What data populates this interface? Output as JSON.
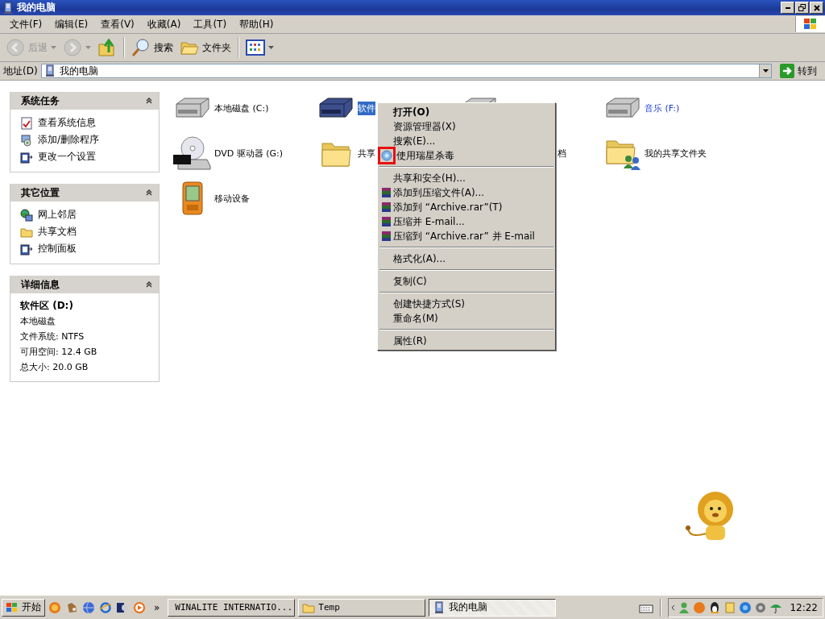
{
  "window": {
    "title": "我的电脑"
  },
  "menu_bar": [
    "文件(F)",
    "编辑(E)",
    "查看(V)",
    "收藏(A)",
    "工具(T)",
    "帮助(H)"
  ],
  "toolbar": [
    {
      "kind": "back",
      "label": "后退",
      "disabled": true
    },
    {
      "kind": "forward",
      "disabled": true
    },
    {
      "kind": "up",
      "disabled": false
    },
    {
      "kind": "search",
      "label": "搜索",
      "disabled": false
    },
    {
      "kind": "folders",
      "label": "文件夹",
      "disabled": false
    },
    {
      "kind": "views",
      "disabled": false
    }
  ],
  "address": {
    "label": "地址(D)",
    "value": "我的电脑",
    "go": "转到"
  },
  "sidebar": [
    {
      "title": "系统任务",
      "expanded": true,
      "items": [
        {
          "label": "查看系统信息"
        },
        {
          "label": "添加/删除程序"
        },
        {
          "label": "更改一个设置"
        }
      ]
    },
    {
      "title": "其它位置",
      "expanded": true,
      "items": [
        {
          "label": "网上邻居"
        },
        {
          "label": "共享文档"
        },
        {
          "label": "控制面板"
        }
      ]
    },
    {
      "title": "详细信息",
      "expanded": true,
      "details": [
        {
          "kind": "name",
          "text": "软件区 (D:)"
        },
        {
          "kind": "line",
          "text": "本地磁盘"
        },
        {
          "kind": "line",
          "text": "文件系统: NTFS"
        },
        {
          "kind": "line",
          "text": "可用空间: 12.4 GB"
        },
        {
          "kind": "line",
          "text": "总大小: 20.0 GB"
        }
      ]
    }
  ],
  "items": [
    {
      "kind": "hdd",
      "label": "本地磁盘 (C:)",
      "selected": false,
      "compressed": false
    },
    {
      "kind": "hdd-dark",
      "label": "软件",
      "selected": true,
      "compressed": false
    },
    {
      "kind": "hdd",
      "selected": false
    },
    {
      "kind": "hdd",
      "label": "音乐 (F:)",
      "selected": false,
      "compressed": true
    },
    {
      "kind": "dvd",
      "label": "DVD 驱动器 (G:)",
      "selected": false,
      "compressed": false
    },
    {
      "kind": "folder",
      "label": "共享",
      "selected": false,
      "compressed": false
    },
    {
      "kind": "folder",
      "label": "档",
      "selected": false,
      "compressed": false
    },
    {
      "kind": "shared",
      "label": "我的共享文件夹",
      "selected": false,
      "compressed": false
    },
    {
      "kind": "mobile",
      "label": "移动设备",
      "selected": false,
      "compressed": false
    }
  ],
  "context_menu": [
    {
      "kind": "plain",
      "label": "打开(O)",
      "default": true
    },
    {
      "kind": "plain",
      "label": "资源管理器(X)",
      "default": false
    },
    {
      "kind": "plain",
      "label": "搜索(E)...",
      "default": false
    },
    {
      "kind": "antivirus",
      "label": "使用瑞星杀毒",
      "default": false
    },
    {
      "kind": "separator"
    },
    {
      "kind": "plain",
      "label": "共享和安全(H)...",
      "default": false
    },
    {
      "kind": "archive",
      "label": "添加到压缩文件(A)...",
      "default": false
    },
    {
      "kind": "archive",
      "label": "添加到 “Archive.rar”(T)",
      "default": false
    },
    {
      "kind": "archive",
      "label": "压缩并 E-mail...",
      "default": false
    },
    {
      "kind": "archive",
      "label": "压缩到 “Archive.rar” 并 E-mail",
      "default": false
    },
    {
      "kind": "separator"
    },
    {
      "kind": "plain",
      "label": "格式化(A)...",
      "default": false
    },
    {
      "kind": "separator"
    },
    {
      "kind": "plain",
      "label": "复制(C)",
      "default": false
    },
    {
      "kind": "separator"
    },
    {
      "kind": "plain",
      "label": "创建快捷方式(S)",
      "default": false
    },
    {
      "kind": "plain",
      "label": "重命名(M)",
      "default": false
    },
    {
      "kind": "separator"
    },
    {
      "kind": "plain",
      "label": "属性(R)",
      "default": false
    }
  ],
  "taskbar": {
    "start": "开始",
    "more": "»",
    "tasks": [
      {
        "label": "WINALITE INTERNATIO...",
        "selected": false
      },
      {
        "label": "Temp",
        "selected": false
      },
      {
        "label": "我的电脑",
        "selected": true
      }
    ],
    "clock": "12:22"
  }
}
